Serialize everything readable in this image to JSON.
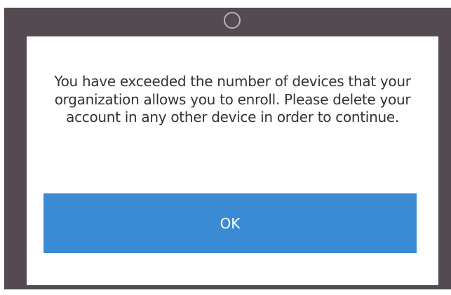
{
  "dialog": {
    "message": "You have exceeded the number of devices that your organization allows you to enroll. Please delete your account in any other device in order to continue.",
    "ok_label": "OK"
  },
  "colors": {
    "backdrop": "#544a52",
    "button": "#3b8bd4",
    "button_text": "#ffffff",
    "message_text": "#333333"
  },
  "icons": {
    "background_indicator": "spinner-icon"
  }
}
